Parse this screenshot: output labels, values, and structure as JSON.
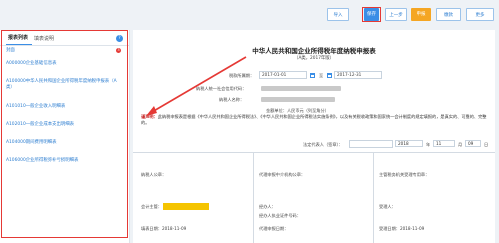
{
  "toolbar": {
    "import_label": "导入",
    "save_label": "保存",
    "prev_label": "上一步",
    "declare_label": "申报",
    "pay_label": "缴款",
    "more_label": "更多"
  },
  "sidebar": {
    "tabs": [
      "报表列表",
      "填表说明"
    ],
    "help_glyph": "?",
    "badge": "3",
    "items": [
      {
        "label": "封面"
      },
      {
        "label": "A000000企业基础信息表"
      },
      {
        "label": "A100000中华人民共和国企业所得税年度纳税申报表（A类）"
      },
      {
        "label": "A101010一般企业收入明细表"
      },
      {
        "label": "A102010一般企业成本支出明细表"
      },
      {
        "label": "A104000期间费用明细表"
      },
      {
        "label": "A106000企业所得税弥补亏损明细表"
      }
    ]
  },
  "form": {
    "title": "中华人民共和国企业所得税年度纳税申报表",
    "subtitle": "（A类，2017年版）",
    "period_label": "税款所属期：",
    "period_start": "2017-01-01",
    "period_sep": "至",
    "period_end": "2017-12-31",
    "taxpayer_id_label": "纳税人统一社会信用代码：",
    "taxpayer_name_label": "纳税人名称：",
    "unit_label": "金额单位：人民币元（列至角分）",
    "notice_prefix": "谨声明：",
    "notice_text": "此纳税申报表是根据《中华人民共和国企业所得税法》、《中华人民共和国企业所得税法实施条例》，以及有关税收政策和国家统一会计制度的规定填报的，是真实的、可靠的、完整的。",
    "sign_label": "法定代表人（签章）：",
    "year": "2018",
    "year_unit": "年",
    "month": "11",
    "month_unit": "月",
    "day": "09",
    "day_unit": "日",
    "col1_sign": "纳税人公章：",
    "col1_accountant": "会计主管：",
    "col1_date": "填表日期：2018-11-09",
    "col2_agent": "代理申报中介机构公章：",
    "col2_handler": "经办人：",
    "col2_cert": "经办人执业证件号码：",
    "col2_date": "代理申报日期：",
    "col3_authority": "主管税务机关受理专用章：",
    "col3_receiver": "受理人：",
    "col3_date": "受理日期：2018-11-09"
  },
  "colors": {
    "accent": "#3a8ee6",
    "highlight": "#e53935",
    "warning": "#f5c400"
  }
}
